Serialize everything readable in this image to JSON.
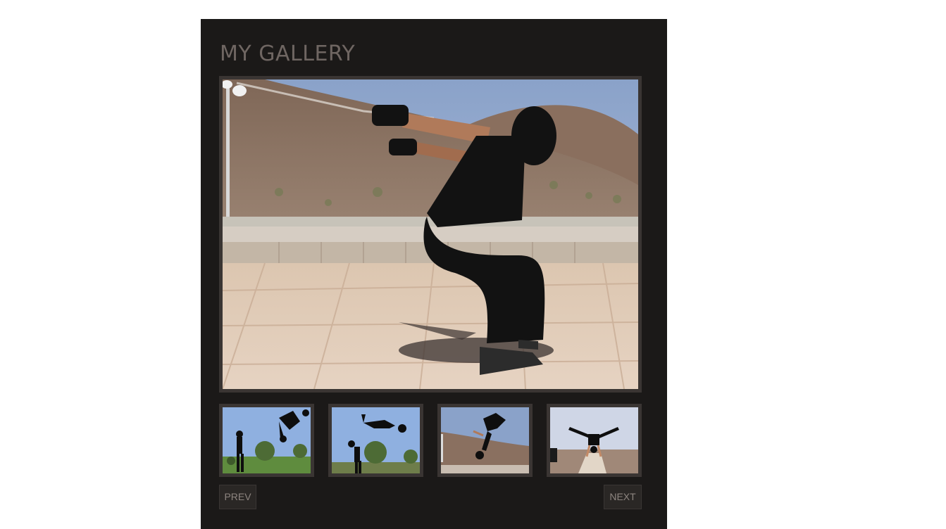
{
  "gallery": {
    "title": "MY GALLERY",
    "main_image": {
      "subject": "person-crouching-jump-photo"
    },
    "thumbnails": [
      {
        "subject": "backflip-partner-photo-1"
      },
      {
        "subject": "backflip-partner-photo-2"
      },
      {
        "subject": "flip-on-hillside-photo"
      },
      {
        "subject": "handstand-on-ledge-photo"
      }
    ],
    "prev_label": "PREV",
    "next_label": "NEXT"
  },
  "colors": {
    "page_background": "#ffffff",
    "panel_background": "#1b1918",
    "frame": "#3a3533",
    "title_text": "#6f6662",
    "button_text": "#8d8580"
  }
}
